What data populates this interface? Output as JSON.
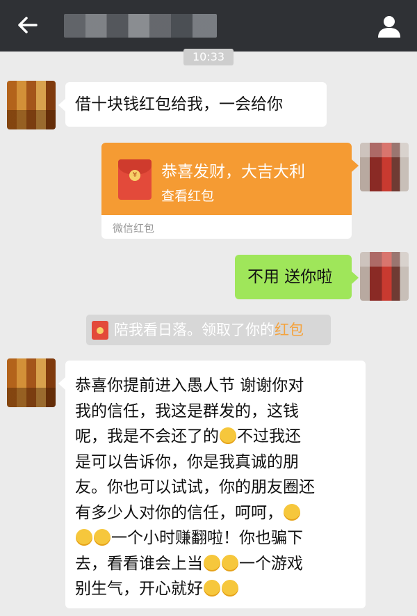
{
  "header": {
    "back_icon": "back-arrow-icon",
    "profile_icon": "person-icon"
  },
  "timestamp": "10:33",
  "messages": {
    "m1": "借十块钱红包给我，一会给你",
    "red_packet": {
      "title": "恭喜发财，大吉大利",
      "subtitle": "查看红包",
      "footer": "微信红包"
    },
    "m2": "不用 送你啦",
    "system_text": "陪我看日落。领取了你的",
    "system_highlight": "红包",
    "long_lines": [
      "恭喜你提前进入愚人节 谢谢你对",
      "我的信任，我这是群发的，这钱",
      "呢，我是不会还了的",
      "不过我还",
      "是可以告诉你，你是我真诚的朋",
      "友。你也可以试试，你的朋友圈还",
      "有多少人对你的信任，呵呵，",
      "一个小时赚翻啦！你也骗下",
      "去，看看谁会上当",
      "一个游戏",
      "别生气，开心就好"
    ]
  },
  "colors": {
    "topbar": "#2f3135",
    "chat_bg": "#ebebeb",
    "green_bubble": "#9fe65a",
    "red_packet_orange": "#f59b33",
    "highlight": "#f4a33e"
  }
}
